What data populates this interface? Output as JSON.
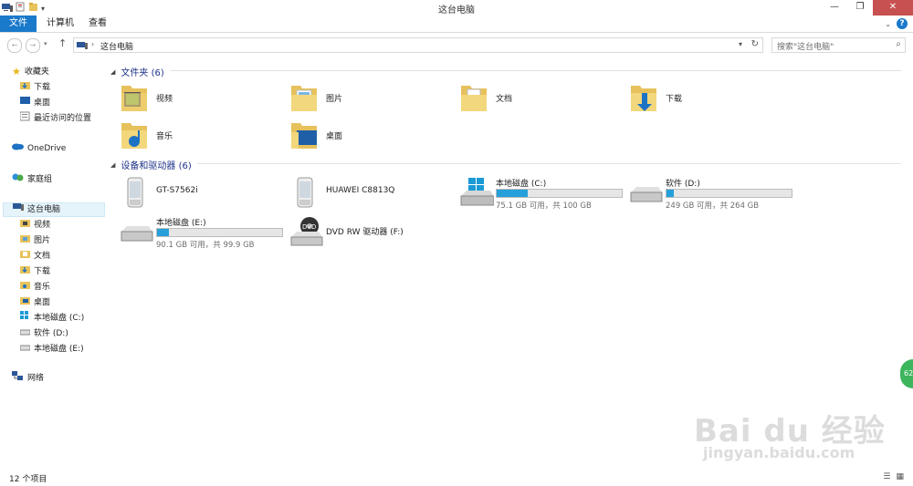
{
  "window": {
    "title": "这台电脑",
    "min": "—",
    "max": "❐",
    "close": "✕"
  },
  "ribbon": {
    "tabs": [
      "文件",
      "计算机",
      "查看"
    ],
    "help": "?"
  },
  "address": {
    "path": "这台电脑",
    "search_placeholder": "搜索\"这台电脑\""
  },
  "sidebar": {
    "favorites": {
      "label": "收藏夹",
      "items": [
        "下载",
        "桌面",
        "最近访问的位置"
      ]
    },
    "onedrive": "OneDrive",
    "homegroup": "家庭组",
    "thispc": {
      "label": "这台电脑",
      "items": [
        "视频",
        "图片",
        "文档",
        "下载",
        "音乐",
        "桌面",
        "本地磁盘 (C:)",
        "软件 (D:)",
        "本地磁盘 (E:)"
      ]
    },
    "network": "网络"
  },
  "folders": {
    "header": "文件夹 (6)",
    "items": [
      {
        "name": "视频",
        "icon": "video-folder-icon"
      },
      {
        "name": "图片",
        "icon": "pictures-folder-icon"
      },
      {
        "name": "文档",
        "icon": "documents-folder-icon"
      },
      {
        "name": "下载",
        "icon": "downloads-folder-icon"
      },
      {
        "name": "音乐",
        "icon": "music-folder-icon"
      },
      {
        "name": "桌面",
        "icon": "desktop-folder-icon"
      }
    ]
  },
  "devices": {
    "header": "设备和驱动器 (6)",
    "phones": [
      "GT-S7562i",
      "HUAWEI C8813Q"
    ],
    "drives": [
      {
        "name": "本地磁盘 (C:)",
        "free": "75.1 GB 可用，共 100 GB",
        "used_fraction": 0.249
      },
      {
        "name": "软件 (D:)",
        "free": "249 GB 可用，共 264 GB",
        "used_fraction": 0.057
      },
      {
        "name": "本地磁盘 (E:)",
        "free": "90.1 GB 可用，共 99.9 GB",
        "used_fraction": 0.098
      }
    ],
    "dvd": "DVD RW 驱动器 (F:)"
  },
  "status": {
    "count": "12 个项目"
  },
  "watermark": {
    "main": "Bai du 经验",
    "sub": "jingyan.baidu.com"
  },
  "badge": "62"
}
